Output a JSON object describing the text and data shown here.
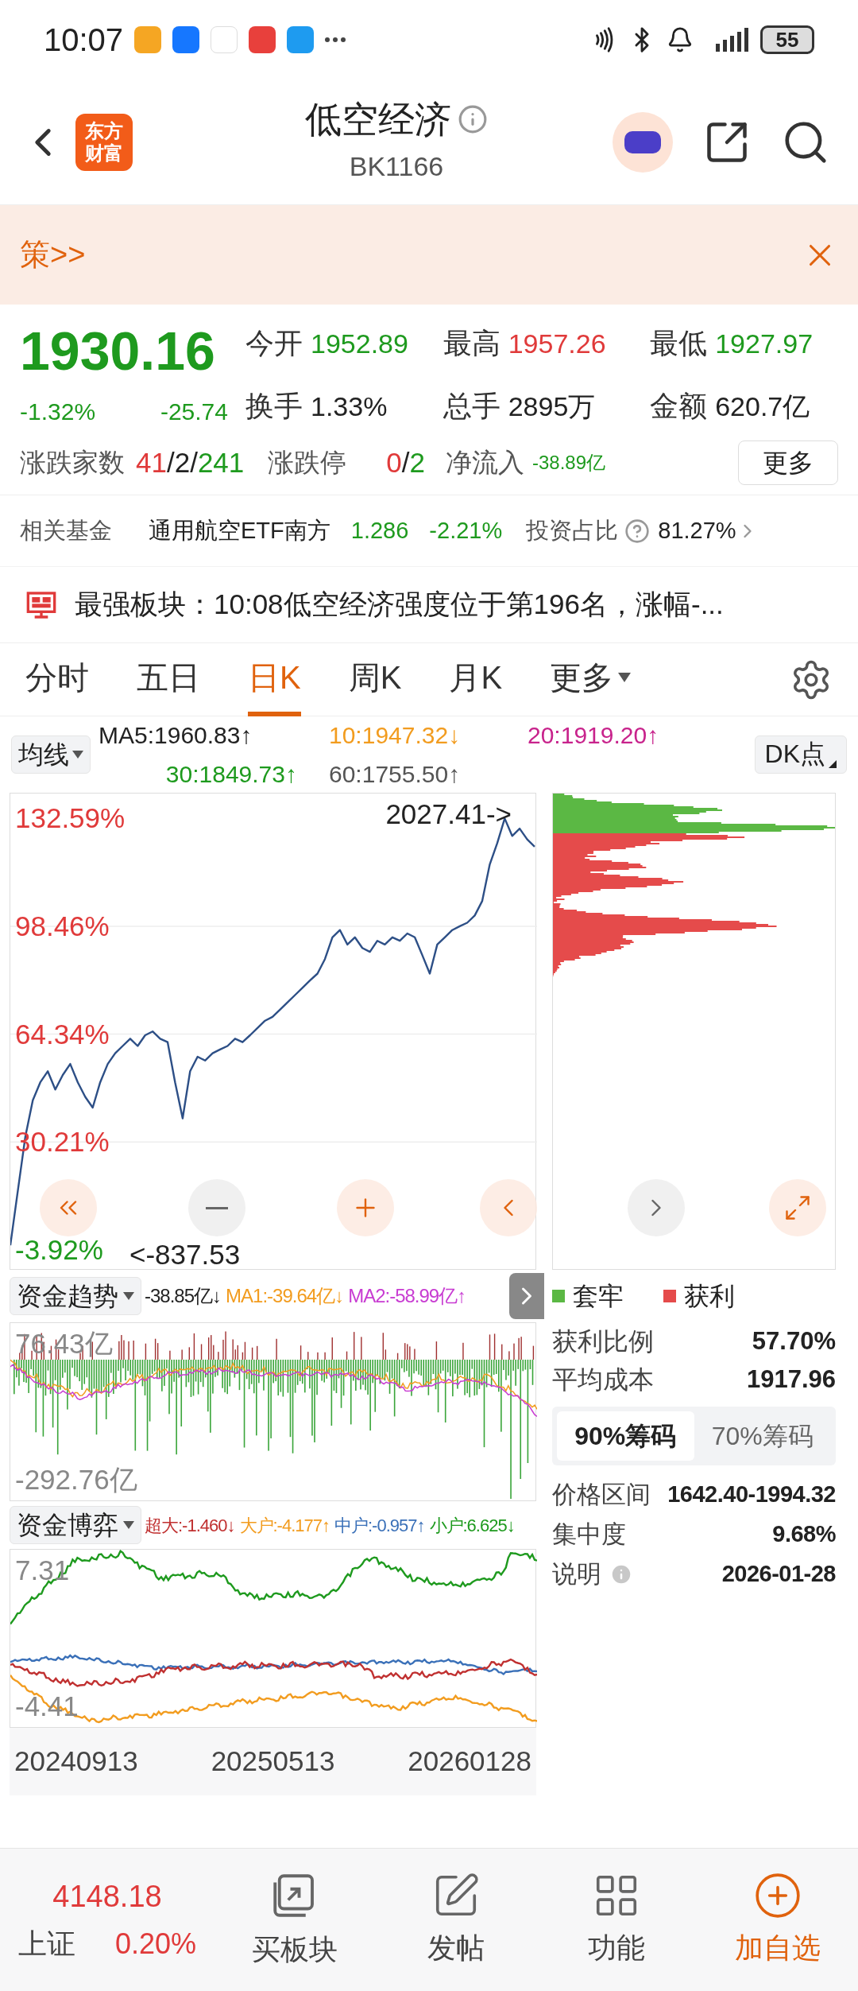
{
  "status_bar": {
    "time": "10:07",
    "battery": "55"
  },
  "header": {
    "logo_lines": [
      "东方",
      "财富"
    ],
    "title": "低空经济",
    "code": "BK1166"
  },
  "banner": {
    "text": "策>>"
  },
  "quote": {
    "price": "1930.16",
    "change_pct": "-1.32%",
    "change": "-25.74",
    "stats": [
      {
        "label": "今开",
        "value": "1952.89",
        "color": "#1e9a1e"
      },
      {
        "label": "最高",
        "value": "1957.26",
        "color": "#e03a3a"
      },
      {
        "label": "最低",
        "value": "1927.97",
        "color": "#1e9a1e"
      },
      {
        "label": "换手",
        "value": "1.33%",
        "color": "#222222"
      },
      {
        "label": "总手",
        "value": "2895万",
        "color": "#222222"
      },
      {
        "label": "金额",
        "value": "620.7亿",
        "color": "#222222"
      }
    ],
    "breadth": {
      "label": "涨跌家数",
      "up": "41",
      "flat": "2",
      "down": "241",
      "sep": "/"
    },
    "limit": {
      "label": "涨跌停",
      "up": "0",
      "down": "2",
      "sep": "/"
    },
    "net_inflow": {
      "label": "净流入",
      "value": "-38.89亿"
    },
    "more_button": "更多"
  },
  "fund": {
    "label": "相关基金",
    "name": "通用航空ETF南方",
    "price": "1.286",
    "change": "-2.21%",
    "ratio_label": "投资占比",
    "ratio": "81.27%"
  },
  "notice": {
    "text": "最强板块：10:08低空经济强度位于第196名，涨幅-..."
  },
  "period_tabs": [
    {
      "label": "分时",
      "selected": false,
      "kind": "tab"
    },
    {
      "label": "五日",
      "selected": false,
      "kind": "tab"
    },
    {
      "label": "日K",
      "selected": true,
      "kind": "tab"
    },
    {
      "label": "周K",
      "selected": false,
      "kind": "tab"
    },
    {
      "label": "月K",
      "selected": false,
      "kind": "tab"
    },
    {
      "label": "更多",
      "selected": false,
      "kind": "dropdown"
    }
  ],
  "indicators": {
    "ma_button": "均线",
    "ma": [
      {
        "text": "MA5:1960.83↑",
        "color": "#222222"
      },
      {
        "text": "10:1947.32↓",
        "color": "#f29c1f"
      },
      {
        "text": "20:1919.20↑",
        "color": "#c8238c"
      },
      {
        "text": "30:1849.73↑",
        "color": "#1e9a1e"
      },
      {
        "text": "60:1755.50↑",
        "color": "#555555"
      }
    ],
    "dk_button": "DK点"
  },
  "price_chart": {
    "chart_data": {
      "type": "line",
      "ylim": [
        -10,
        140
      ],
      "grid": true,
      "yticks": [
        {
          "value": 132.59,
          "label": "132.59%"
        },
        {
          "value": 98.46,
          "label": "98.46%"
        },
        {
          "value": 64.34,
          "label": "64.34%"
        },
        {
          "value": 30.21,
          "label": "30.21%"
        },
        {
          "value": -3.92,
          "label": "-3.92%"
        }
      ],
      "series": [
        {
          "color": "#2d4f86",
          "values": [
            -2.5,
            14.7,
            31.9,
            43.4,
            49.1,
            52.6,
            46.8,
            51.4,
            54.9,
            49.1,
            44.5,
            41.1,
            49.1,
            54.9,
            58.3,
            60.6,
            62.9,
            60.6,
            64.0,
            65.2,
            62.9,
            61.8,
            49.1,
            37.7,
            52.6,
            57.2,
            56.0,
            58.3,
            59.5,
            60.6,
            62.9,
            61.8,
            64.0,
            66.3,
            68.6,
            69.8,
            72.1,
            74.4,
            76.7,
            79.0,
            81.3,
            83.5,
            88.1,
            95.0,
            97.3,
            92.7,
            95.0,
            91.6,
            90.4,
            93.9,
            92.7,
            95.0,
            93.9,
            96.2,
            95.0,
            89.3,
            83.5,
            92.7,
            95.0,
            97.3,
            98.5,
            99.6,
            101.9,
            106.5,
            118.0,
            124.8,
            132.6,
            127.1,
            129.4,
            126.0,
            123.7
          ]
        }
      ]
    },
    "max_label": "2027.41->",
    "min_label": "<-837.53"
  },
  "fund_trend": {
    "button": "资金趋势",
    "values": [
      {
        "text": "-38.85亿↓",
        "color": "#222222"
      },
      {
        "text": "MA1:-39.64亿↓",
        "color": "#f29c1f"
      },
      {
        "text": "MA2:-58.99亿↑",
        "color": "#c83cd2"
      }
    ],
    "top_label": "76.43亿",
    "bottom_label": "-292.76亿"
  },
  "fund_game": {
    "button": "资金博弈",
    "values": [
      {
        "text": "超大:-1.460↓",
        "color": "#c03030"
      },
      {
        "text": "大户:-4.177↑",
        "color": "#f29c1f"
      },
      {
        "text": "中户:-0.957↑",
        "color": "#3a70b8"
      },
      {
        "text": "小户:6.625↓",
        "color": "#1e9a1e"
      }
    ],
    "top_label": "7.31",
    "bottom_label": "-4.41"
  },
  "dates": [
    "20240913",
    "20250513",
    "20260128"
  ],
  "chip_panel": {
    "legend": [
      {
        "label": "套牢",
        "color": "#5bb844"
      },
      {
        "label": "获利",
        "color": "#e54b4b"
      }
    ],
    "rows": [
      {
        "label": "获利比例",
        "value": "57.70%"
      },
      {
        "label": "平均成本",
        "value": "1917.96"
      }
    ],
    "tabs": [
      {
        "label": "90%筹码",
        "selected": true
      },
      {
        "label": "70%筹码",
        "selected": false
      }
    ],
    "details": [
      {
        "label": "价格区间",
        "value": "1642.40-1994.32",
        "info": false
      },
      {
        "label": "集中度",
        "value": "9.68%",
        "info": false
      },
      {
        "label": "说明",
        "value": "2026-01-28",
        "info": true
      }
    ]
  },
  "bottom_nav": {
    "index": {
      "value": "4148.18",
      "name": "上证",
      "change": "0.20%"
    },
    "items": [
      {
        "label": "买板块",
        "kind": "buy",
        "accent": false
      },
      {
        "label": "发帖",
        "kind": "post",
        "accent": false
      },
      {
        "label": "功能",
        "kind": "tools",
        "accent": false
      },
      {
        "label": "加自选",
        "kind": "add",
        "accent": true
      }
    ]
  }
}
